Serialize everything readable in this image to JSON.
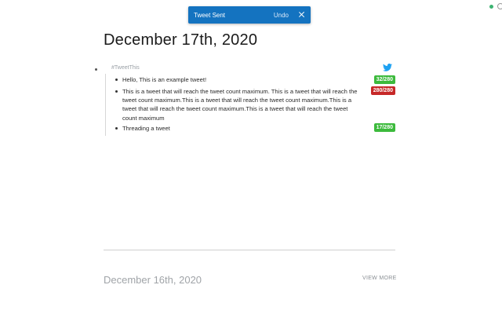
{
  "toast": {
    "message": "Tweet Sent",
    "undo_label": "Undo",
    "close_icon": "close-icon"
  },
  "page": {
    "title": "December 17th, 2020"
  },
  "root_block": {
    "label": "#TweetThis",
    "icon": "twitter-bird-icon"
  },
  "tweets": [
    {
      "text": "Hello, This is an example tweet!",
      "count": "32/280",
      "color": "#3cba3c"
    },
    {
      "text": "This is a tweet that will reach the tweet count maximum. This is a tweet that will reach the tweet count maximum.This is a tweet that will reach the tweet count maximum.This is a tweet that will reach the tweet count maximum.This is a tweet that will reach the tweet count maximum",
      "count": "280/280",
      "color": "#c62828"
    },
    {
      "text": "Threading a tweet",
      "count": "17/280",
      "color": "#3cba3c"
    }
  ],
  "next_page": {
    "title": "December 16th, 2020",
    "view_more_label": "VIEW MORE"
  },
  "colors": {
    "accent": "#1473c0",
    "twitter_blue": "#1da1f2"
  }
}
